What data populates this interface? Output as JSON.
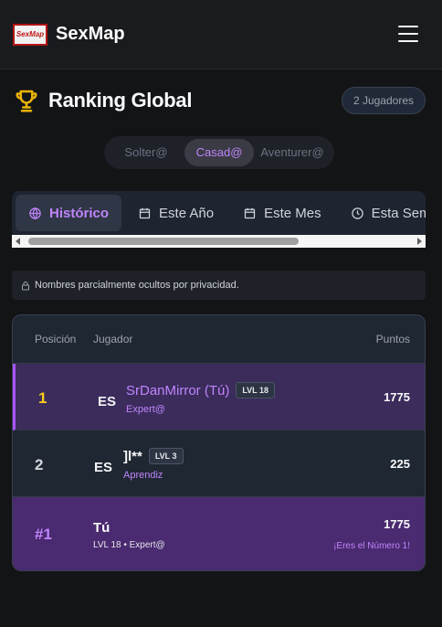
{
  "app": {
    "brand": "SexMap",
    "logo_text": "SexMap"
  },
  "header": {
    "title": "Ranking Global",
    "player_count": "2 Jugadores"
  },
  "categories": {
    "items": [
      "Solter@",
      "Casad@",
      "Aventurer@"
    ],
    "selected": "Casad@"
  },
  "periods": {
    "items": [
      {
        "label": "Histórico",
        "icon": "globe-icon"
      },
      {
        "label": "Este Año",
        "icon": "calendar-icon"
      },
      {
        "label": "Este Mes",
        "icon": "calendar-icon"
      },
      {
        "label": "Esta Semana",
        "icon": "clock-icon"
      }
    ],
    "selected": "Histórico"
  },
  "privacy_notice": "Nombres parcialmente ocultos por privacidad.",
  "table": {
    "headers": {
      "position": "Posición",
      "player": "Jugador",
      "points": "Puntos"
    },
    "rows": [
      {
        "rank": "1",
        "flag": "ES",
        "name": "SrDanMirror (Tú)",
        "level": "LVL 18",
        "tier": "Expert@",
        "points": "1775"
      },
      {
        "rank": "2",
        "flag": "ES",
        "name": "]l**",
        "level": "LVL 3",
        "tier": "Aprendiz",
        "points": "225"
      }
    ]
  },
  "you": {
    "rank": "#1",
    "name": "Tú",
    "meta": "LVL 18 • Expert@",
    "points": "1775",
    "note": "¡Eres el Número 1!"
  },
  "colors": {
    "accent": "#c084fc",
    "gold": "#facc15",
    "background": "#131416"
  }
}
